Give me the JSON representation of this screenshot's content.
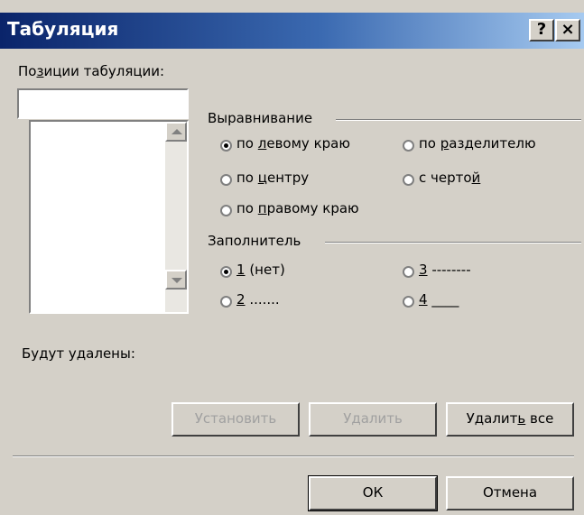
{
  "window": {
    "title": "Табуляция",
    "help_label": "?",
    "close_label": "×"
  },
  "tabs": {
    "positions_label_pre": "По",
    "positions_label_u": "з",
    "positions_label_post": "иции табуляции:",
    "position_value": "",
    "list_items": []
  },
  "alignment": {
    "legend": "Выравнивание",
    "options": [
      {
        "pre": "по ",
        "u": "л",
        "post": "евому краю",
        "selected": true
      },
      {
        "pre": "по ",
        "u": "р",
        "post": "азделителю",
        "selected": false
      },
      {
        "pre": "по ",
        "u": "ц",
        "post": "ентру",
        "selected": false
      },
      {
        "pre": "с черто",
        "u": "й",
        "post": "",
        "selected": false
      },
      {
        "pre": "по ",
        "u": "п",
        "post": "равому краю",
        "selected": false
      }
    ]
  },
  "leader": {
    "legend": "Заполнитель",
    "options": [
      {
        "u": "1",
        "post": " (нет)",
        "selected": true
      },
      {
        "u": "3",
        "post": " --------",
        "selected": false
      },
      {
        "u": "2",
        "post": " .......",
        "selected": false
      },
      {
        "u": "4",
        "post": " ____",
        "selected": false
      }
    ]
  },
  "deleted_label": "Будут удалены:",
  "buttons": {
    "set": "Установить",
    "delete": "Удалить",
    "delete_all_pre": "Удалит",
    "delete_all_u": "ь",
    "delete_all_post": " все",
    "ok": "ОК",
    "cancel": "Отмена"
  }
}
